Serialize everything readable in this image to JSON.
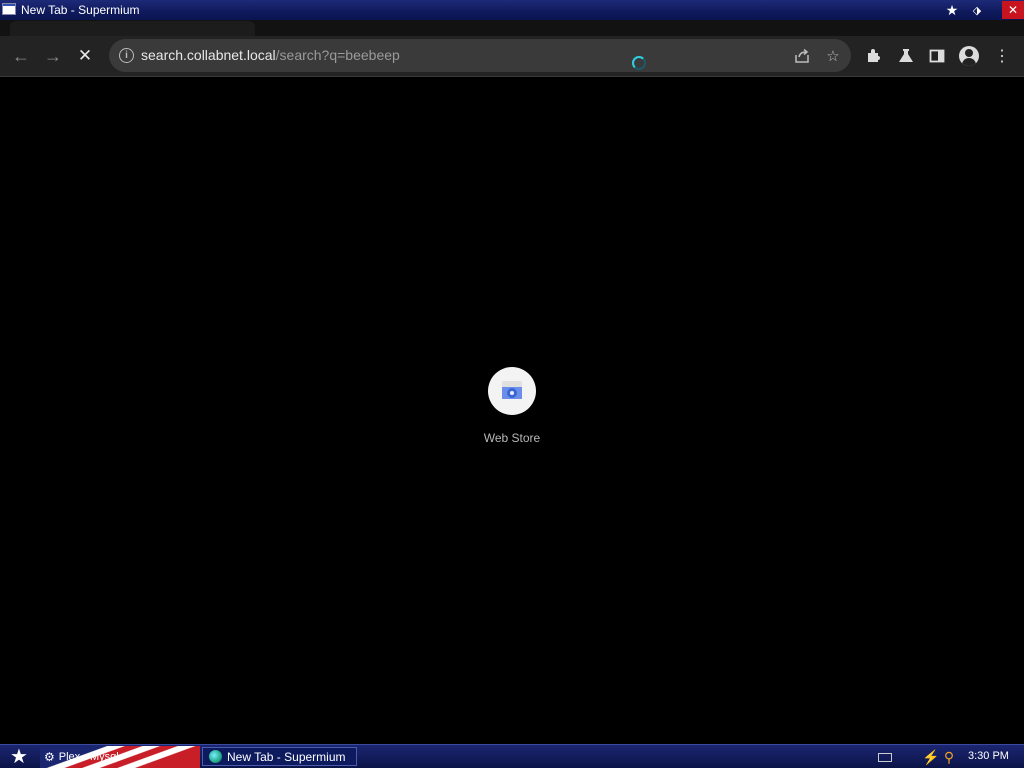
{
  "window": {
    "title": "New Tab - Supermium",
    "buttons": {
      "pin_icon": "star-pin-icon",
      "restore_icon": "restore-icon",
      "close_icon": "close-icon"
    }
  },
  "toolbar": {
    "back_icon": "arrow-left-icon",
    "forward_icon": "arrow-right-icon",
    "stop_icon": "close-x-icon",
    "url_host": "search.collabnet.local",
    "url_rest": "/search?q=beebeep",
    "share_icon": "share-icon",
    "bookmark_icon": "star-outline-icon",
    "extensions_icon": "puzzle-icon",
    "labs_icon": "flask-icon",
    "sidepanel_icon": "side-panel-icon",
    "profile_icon": "account-circle-icon",
    "menu_icon": "kebab-menu-icon"
  },
  "page": {
    "shortcuts": [
      {
        "label": "Web Store",
        "icon": "webstore-icon"
      }
    ]
  },
  "taskbar": {
    "start_icon": "star-start-icon",
    "tasks": [
      {
        "label": "Plex - Mysql",
        "icon": "app-icon"
      },
      {
        "label": "New Tab - Supermium",
        "icon": "supermium-icon"
      }
    ],
    "tray": {
      "clock": "3:30 PM",
      "keyboard_icon": "keyboard-icon",
      "network_icon": "network-icon",
      "search_icon": "magnifier-icon"
    }
  },
  "colors": {
    "titlebar": "#0f1a5c",
    "close": "#c8141e",
    "toolbar": "#232323",
    "omnibox": "#3a3a3a",
    "spinner": "#2fd0e0",
    "content": "#000000"
  }
}
